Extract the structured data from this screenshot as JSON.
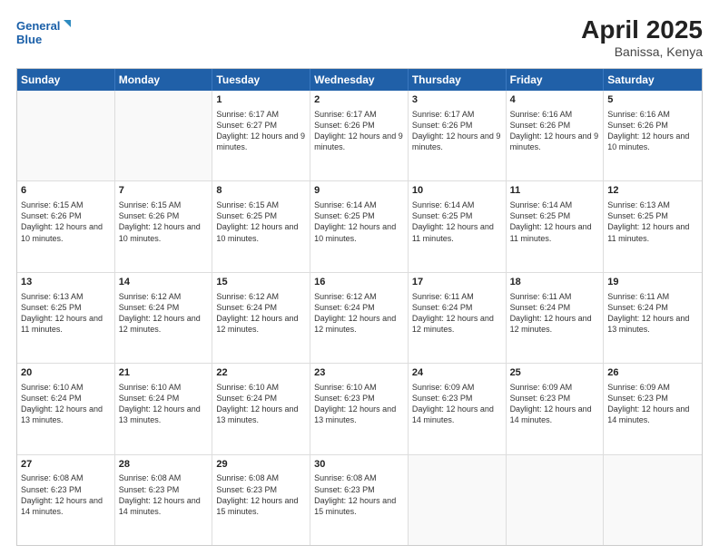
{
  "header": {
    "logo_line1": "General",
    "logo_line2": "Blue",
    "title": "April 2025",
    "subtitle": "Banissa, Kenya"
  },
  "days_of_week": [
    "Sunday",
    "Monday",
    "Tuesday",
    "Wednesday",
    "Thursday",
    "Friday",
    "Saturday"
  ],
  "weeks": [
    [
      {
        "day": "",
        "info": ""
      },
      {
        "day": "",
        "info": ""
      },
      {
        "day": "1",
        "info": "Sunrise: 6:17 AM\nSunset: 6:27 PM\nDaylight: 12 hours and 9 minutes."
      },
      {
        "day": "2",
        "info": "Sunrise: 6:17 AM\nSunset: 6:26 PM\nDaylight: 12 hours and 9 minutes."
      },
      {
        "day": "3",
        "info": "Sunrise: 6:17 AM\nSunset: 6:26 PM\nDaylight: 12 hours and 9 minutes."
      },
      {
        "day": "4",
        "info": "Sunrise: 6:16 AM\nSunset: 6:26 PM\nDaylight: 12 hours and 9 minutes."
      },
      {
        "day": "5",
        "info": "Sunrise: 6:16 AM\nSunset: 6:26 PM\nDaylight: 12 hours and 10 minutes."
      }
    ],
    [
      {
        "day": "6",
        "info": "Sunrise: 6:15 AM\nSunset: 6:26 PM\nDaylight: 12 hours and 10 minutes."
      },
      {
        "day": "7",
        "info": "Sunrise: 6:15 AM\nSunset: 6:26 PM\nDaylight: 12 hours and 10 minutes."
      },
      {
        "day": "8",
        "info": "Sunrise: 6:15 AM\nSunset: 6:25 PM\nDaylight: 12 hours and 10 minutes."
      },
      {
        "day": "9",
        "info": "Sunrise: 6:14 AM\nSunset: 6:25 PM\nDaylight: 12 hours and 10 minutes."
      },
      {
        "day": "10",
        "info": "Sunrise: 6:14 AM\nSunset: 6:25 PM\nDaylight: 12 hours and 11 minutes."
      },
      {
        "day": "11",
        "info": "Sunrise: 6:14 AM\nSunset: 6:25 PM\nDaylight: 12 hours and 11 minutes."
      },
      {
        "day": "12",
        "info": "Sunrise: 6:13 AM\nSunset: 6:25 PM\nDaylight: 12 hours and 11 minutes."
      }
    ],
    [
      {
        "day": "13",
        "info": "Sunrise: 6:13 AM\nSunset: 6:25 PM\nDaylight: 12 hours and 11 minutes."
      },
      {
        "day": "14",
        "info": "Sunrise: 6:12 AM\nSunset: 6:24 PM\nDaylight: 12 hours and 12 minutes."
      },
      {
        "day": "15",
        "info": "Sunrise: 6:12 AM\nSunset: 6:24 PM\nDaylight: 12 hours and 12 minutes."
      },
      {
        "day": "16",
        "info": "Sunrise: 6:12 AM\nSunset: 6:24 PM\nDaylight: 12 hours and 12 minutes."
      },
      {
        "day": "17",
        "info": "Sunrise: 6:11 AM\nSunset: 6:24 PM\nDaylight: 12 hours and 12 minutes."
      },
      {
        "day": "18",
        "info": "Sunrise: 6:11 AM\nSunset: 6:24 PM\nDaylight: 12 hours and 12 minutes."
      },
      {
        "day": "19",
        "info": "Sunrise: 6:11 AM\nSunset: 6:24 PM\nDaylight: 12 hours and 13 minutes."
      }
    ],
    [
      {
        "day": "20",
        "info": "Sunrise: 6:10 AM\nSunset: 6:24 PM\nDaylight: 12 hours and 13 minutes."
      },
      {
        "day": "21",
        "info": "Sunrise: 6:10 AM\nSunset: 6:24 PM\nDaylight: 12 hours and 13 minutes."
      },
      {
        "day": "22",
        "info": "Sunrise: 6:10 AM\nSunset: 6:24 PM\nDaylight: 12 hours and 13 minutes."
      },
      {
        "day": "23",
        "info": "Sunrise: 6:10 AM\nSunset: 6:23 PM\nDaylight: 12 hours and 13 minutes."
      },
      {
        "day": "24",
        "info": "Sunrise: 6:09 AM\nSunset: 6:23 PM\nDaylight: 12 hours and 14 minutes."
      },
      {
        "day": "25",
        "info": "Sunrise: 6:09 AM\nSunset: 6:23 PM\nDaylight: 12 hours and 14 minutes."
      },
      {
        "day": "26",
        "info": "Sunrise: 6:09 AM\nSunset: 6:23 PM\nDaylight: 12 hours and 14 minutes."
      }
    ],
    [
      {
        "day": "27",
        "info": "Sunrise: 6:08 AM\nSunset: 6:23 PM\nDaylight: 12 hours and 14 minutes."
      },
      {
        "day": "28",
        "info": "Sunrise: 6:08 AM\nSunset: 6:23 PM\nDaylight: 12 hours and 14 minutes."
      },
      {
        "day": "29",
        "info": "Sunrise: 6:08 AM\nSunset: 6:23 PM\nDaylight: 12 hours and 15 minutes."
      },
      {
        "day": "30",
        "info": "Sunrise: 6:08 AM\nSunset: 6:23 PM\nDaylight: 12 hours and 15 minutes."
      },
      {
        "day": "",
        "info": ""
      },
      {
        "day": "",
        "info": ""
      },
      {
        "day": "",
        "info": ""
      }
    ]
  ]
}
